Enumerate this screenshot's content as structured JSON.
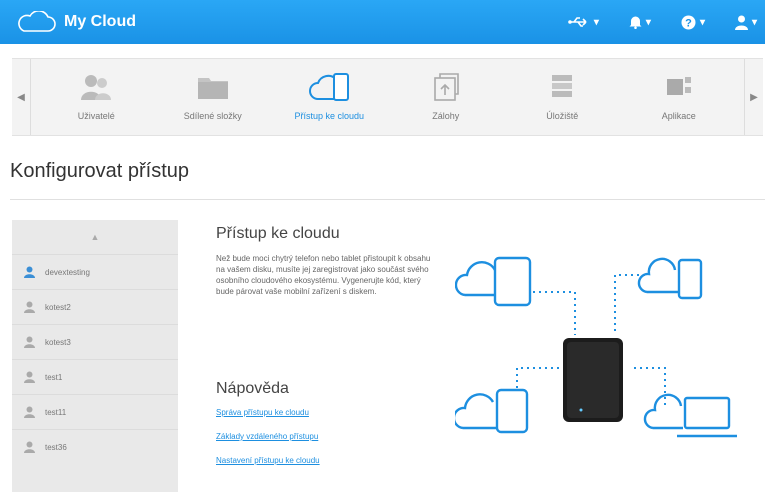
{
  "app": {
    "title": "My Cloud"
  },
  "top": {
    "usb": {
      "icon": "usb-icon"
    },
    "notifications": {
      "icon": "bell-icon"
    },
    "help": {
      "icon": "help-icon"
    },
    "user": {
      "icon": "user-icon"
    }
  },
  "nav": {
    "items": [
      {
        "label": "Uživatelé",
        "icon": "users-icon"
      },
      {
        "label": "Sdílené složky",
        "icon": "shares-icon"
      },
      {
        "label": "Přístup ke cloudu",
        "icon": "cloud-access-icon",
        "active": true
      },
      {
        "label": "Zálohy",
        "icon": "backups-icon"
      },
      {
        "label": "Úložiště",
        "icon": "storage-icon"
      },
      {
        "label": "Aplikace",
        "icon": "apps-icon"
      }
    ]
  },
  "page": {
    "title": "Konfigurovat přístup"
  },
  "users": [
    {
      "name": "devextesting",
      "active": true
    },
    {
      "name": "kotest2"
    },
    {
      "name": "kotest3"
    },
    {
      "name": "test1"
    },
    {
      "name": "test11"
    },
    {
      "name": "test36"
    }
  ],
  "content": {
    "title": "Přístup ke cloudu",
    "description": "Než bude moci chytrý telefon nebo tablet přistoupit k obsahu na vašem disku, musíte jej zaregistrovat jako součást svého osobního cloudového ekosystému. Vygenerujte kód, který bude párovat vaše mobilní zařízení s diskem.",
    "help_title": "Nápověda",
    "links": [
      "Správa přístupu ke cloudu",
      "Základy vzdáleného přístupu",
      "Nastavení přístupu ke cloudu"
    ]
  },
  "colors": {
    "accent": "#1d8fe0",
    "topbar": "#1a92e6"
  }
}
